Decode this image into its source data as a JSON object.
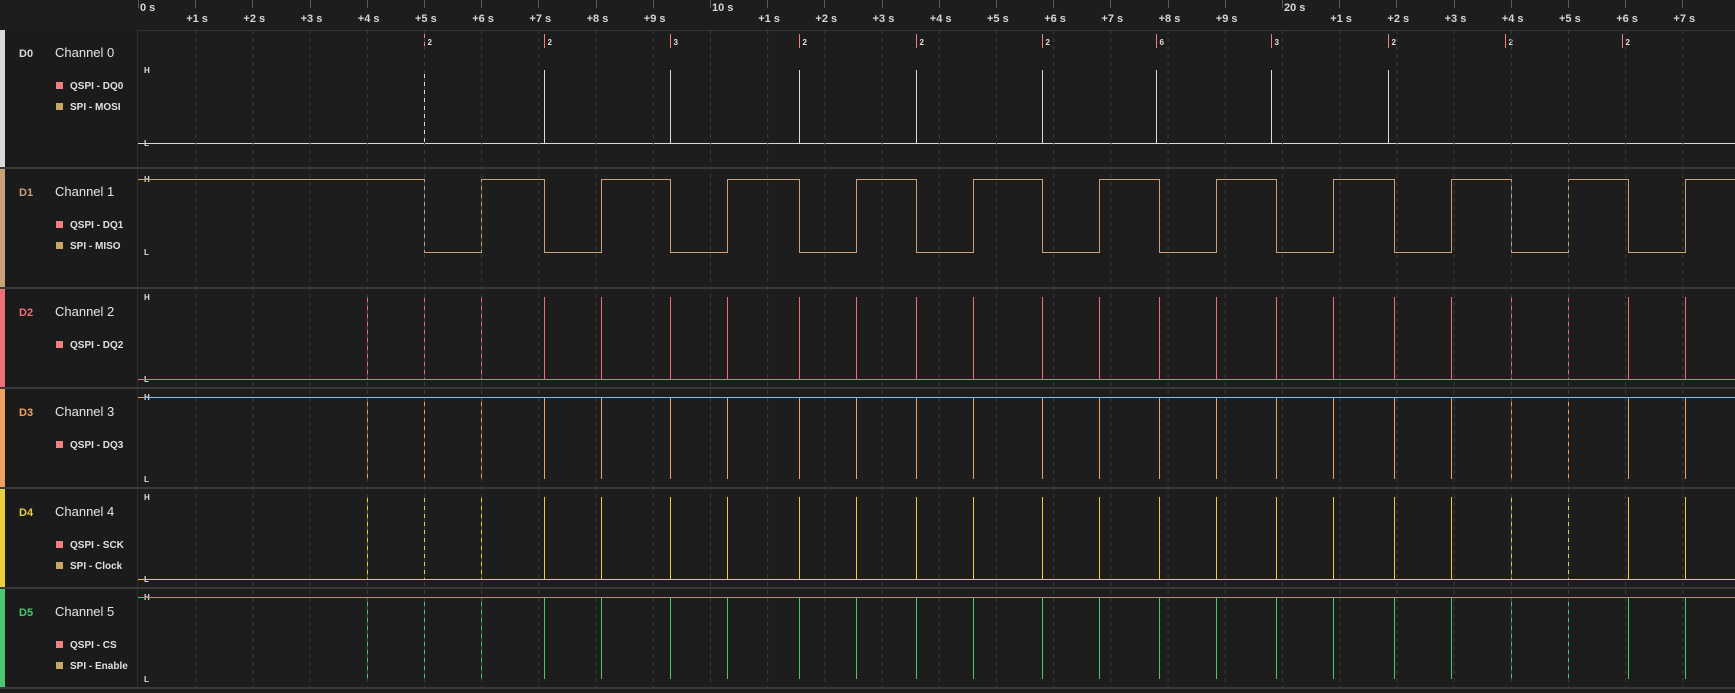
{
  "timeline": {
    "ticks": [
      {
        "label": "0 s",
        "major": true
      },
      {
        "label": "+1 s",
        "major": false
      },
      {
        "label": "+2 s",
        "major": false
      },
      {
        "label": "+3 s",
        "major": false
      },
      {
        "label": "+4 s",
        "major": false
      },
      {
        "label": "+5 s",
        "major": false
      },
      {
        "label": "+6 s",
        "major": false
      },
      {
        "label": "+7 s",
        "major": false
      },
      {
        "label": "+8 s",
        "major": false
      },
      {
        "label": "+9 s",
        "major": false
      },
      {
        "label": "10 s",
        "major": true
      },
      {
        "label": "+1 s",
        "major": false
      },
      {
        "label": "+2 s",
        "major": false
      },
      {
        "label": "+3 s",
        "major": false
      },
      {
        "label": "+4 s",
        "major": false
      },
      {
        "label": "+5 s",
        "major": false
      },
      {
        "label": "+6 s",
        "major": false
      },
      {
        "label": "+7 s",
        "major": false
      },
      {
        "label": "+8 s",
        "major": false
      },
      {
        "label": "+9 s",
        "major": false
      },
      {
        "label": "20 s",
        "major": true
      },
      {
        "label": "+1 s",
        "major": false
      },
      {
        "label": "+2 s",
        "major": false
      },
      {
        "label": "+3 s",
        "major": false
      },
      {
        "label": "+4 s",
        "major": false
      },
      {
        "label": "+5 s",
        "major": false
      },
      {
        "label": "+6 s",
        "major": false
      },
      {
        "label": "+7 s",
        "major": false
      }
    ]
  },
  "level_labels": {
    "high": "H",
    "low": "L"
  },
  "channels": [
    {
      "id": "D0",
      "name": "Channel 0",
      "color": "#d9d9d9",
      "analyzers": [
        {
          "label": "QSPI - DQ0",
          "color": "#f08080"
        },
        {
          "label": "SPI - MOSI",
          "color": "#c8a860"
        }
      ],
      "kind": "pulse-high",
      "pulses": [
        5.0,
        7.1,
        9.3,
        11.55,
        13.6,
        15.8,
        17.8,
        19.8,
        21.85
      ],
      "marker_values": [
        "2",
        "2",
        "3",
        "2",
        "2",
        "2",
        "6",
        "3",
        "2",
        "2",
        "2"
      ],
      "marker_times": [
        5.0,
        7.1,
        9.3,
        11.55,
        13.6,
        15.8,
        17.8,
        19.8,
        21.85,
        23.9,
        25.95
      ]
    },
    {
      "id": "D1",
      "name": "Channel 1",
      "color": "#c9a27a",
      "analyzers": [
        {
          "label": "QSPI - DQ1",
          "color": "#f08080"
        },
        {
          "label": "SPI - MISO",
          "color": "#c8a860"
        }
      ],
      "kind": "square",
      "low_intervals": [
        [
          5.0,
          6.0
        ],
        [
          7.1,
          8.1
        ],
        [
          9.3,
          10.3
        ],
        [
          11.55,
          12.55
        ],
        [
          13.6,
          14.6
        ],
        [
          15.8,
          16.8
        ],
        [
          17.85,
          18.85
        ],
        [
          19.9,
          20.9
        ],
        [
          21.95,
          22.95
        ],
        [
          24.0,
          25.0
        ],
        [
          26.05,
          27.05
        ]
      ]
    },
    {
      "id": "D2",
      "name": "Channel 2",
      "color": "#f07078",
      "analyzers": [
        {
          "label": "QSPI - DQ2",
          "color": "#f08080"
        }
      ],
      "kind": "pulse-high",
      "pulses": [
        4.0,
        5.0,
        6.0,
        7.1,
        8.1,
        9.3,
        10.3,
        11.55,
        12.55,
        13.6,
        14.6,
        15.8,
        16.8,
        17.85,
        18.85,
        19.9,
        20.9,
        21.95,
        22.95,
        24.0,
        25.0,
        26.05,
        27.05
      ]
    },
    {
      "id": "D3",
      "name": "Channel 3",
      "color": "#f0a060",
      "analyzers": [
        {
          "label": "QSPI - DQ3",
          "color": "#f08080"
        }
      ],
      "kind": "pulse-low",
      "pulses": [
        4.0,
        5.0,
        6.0,
        7.1,
        8.1,
        9.3,
        10.3,
        11.55,
        12.55,
        13.6,
        14.6,
        15.8,
        16.8,
        17.85,
        18.85,
        19.9,
        20.9,
        21.95,
        22.95,
        24.0,
        25.0,
        26.05,
        27.05
      ]
    },
    {
      "id": "D4",
      "name": "Channel 4",
      "color": "#e8d040",
      "analyzers": [
        {
          "label": "QSPI - SCK",
          "color": "#f08080"
        },
        {
          "label": "SPI - Clock",
          "color": "#c8a860"
        }
      ],
      "kind": "pulse-high",
      "pulses": [
        4.0,
        5.0,
        6.0,
        7.1,
        8.1,
        9.3,
        10.3,
        11.55,
        12.55,
        13.6,
        14.6,
        15.8,
        16.8,
        17.85,
        18.85,
        19.9,
        20.9,
        21.95,
        22.95,
        24.0,
        25.0,
        26.05,
        27.05
      ]
    },
    {
      "id": "D5",
      "name": "Channel 5",
      "color": "#48c870",
      "analyzers": [
        {
          "label": "QSPI - CS",
          "color": "#f08080"
        },
        {
          "label": "SPI - Enable",
          "color": "#c8a860"
        }
      ],
      "kind": "pulse-low",
      "pulses": [
        4.0,
        5.0,
        6.0,
        7.1,
        8.1,
        9.3,
        10.3,
        11.55,
        12.55,
        13.6,
        14.6,
        15.8,
        16.8,
        17.85,
        18.85,
        19.9,
        20.9,
        21.95,
        22.95,
        24.0,
        25.0,
        26.05,
        27.05
      ]
    }
  ]
}
